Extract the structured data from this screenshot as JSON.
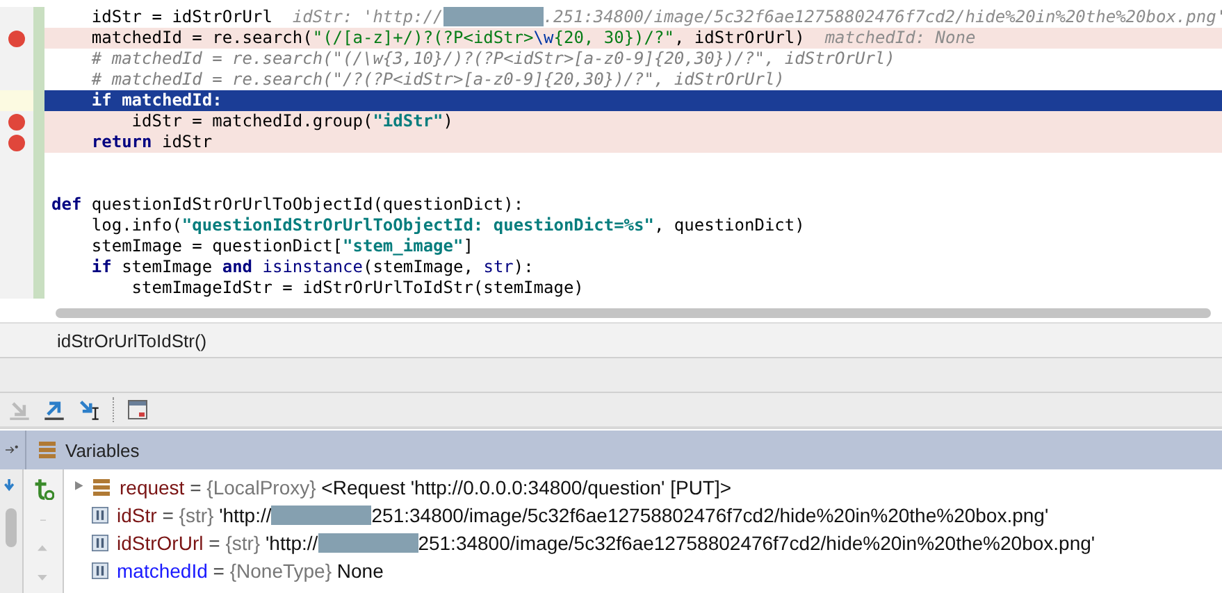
{
  "editor": {
    "lines": [
      {
        "breakpoint": false,
        "current": false,
        "segments": [
          {
            "kind": "plain",
            "text": "    idStr = idStrOrUrl"
          },
          {
            "kind": "hint",
            "text": "  idStr: 'http://"
          },
          {
            "kind": "redacted"
          },
          {
            "kind": "hint",
            "text": ".251:34800/image/5c32f6ae12758802476f7cd2/hide%20in%20the%20box.png'"
          }
        ]
      },
      {
        "breakpoint": true,
        "current": false,
        "segments": [
          {
            "kind": "plain",
            "text": "    matchedId = re.search("
          },
          {
            "kind": "string",
            "text": "\"(/[a-z]+/)?(?P<idStr>"
          },
          {
            "kind": "escape",
            "text": "\\w"
          },
          {
            "kind": "string",
            "text": "{20, 30})/?\""
          },
          {
            "kind": "plain",
            "text": ", idStrOrUrl)"
          },
          {
            "kind": "hint",
            "text": "  matchedId: None"
          }
        ]
      },
      {
        "breakpoint": false,
        "current": false,
        "segments": [
          {
            "kind": "comment",
            "text": "    # matchedId = re.search(\"(/\\w{3,10}/)?(?P<idStr>[a-z0-9]{20,30})/?\", idStrOrUrl)"
          }
        ]
      },
      {
        "breakpoint": false,
        "current": false,
        "segments": [
          {
            "kind": "comment",
            "text": "    # matchedId = re.search(\"/?(?P<idStr>[a-z0-9]{20,30})/?\", idStrOrUrl)"
          }
        ]
      },
      {
        "breakpoint": false,
        "current": true,
        "segments": [
          {
            "kind": "keyword",
            "text": "    if"
          },
          {
            "kind": "plain",
            "text": " matchedId:"
          }
        ]
      },
      {
        "breakpoint": true,
        "current": false,
        "segments": [
          {
            "kind": "plain",
            "text": "        idStr = matchedId.group("
          },
          {
            "kind": "boldstring",
            "text": "\"idStr\""
          },
          {
            "kind": "plain",
            "text": ")"
          }
        ]
      },
      {
        "breakpoint": true,
        "current": false,
        "segments": [
          {
            "kind": "keyword",
            "text": "    return"
          },
          {
            "kind": "plain",
            "text": " idStr"
          }
        ]
      },
      {
        "breakpoint": false,
        "current": false
      },
      {
        "breakpoint": false,
        "current": false
      },
      {
        "breakpoint": false,
        "current": false,
        "segments": [
          {
            "kind": "keyword",
            "text": "def"
          },
          {
            "kind": "plain",
            "text": " questionIdStrOrUrlToObjectId(questionDict):"
          }
        ]
      },
      {
        "breakpoint": false,
        "current": false,
        "segments": [
          {
            "kind": "plain",
            "text": "    log.info("
          },
          {
            "kind": "boldstring",
            "text": "\"questionIdStrOrUrlToObjectId: questionDict=%s\""
          },
          {
            "kind": "plain",
            "text": ", questionDict)"
          }
        ]
      },
      {
        "breakpoint": false,
        "current": false,
        "segments": [
          {
            "kind": "plain",
            "text": "    stemImage = questionDict["
          },
          {
            "kind": "boldstring",
            "text": "\"stem_image\""
          },
          {
            "kind": "plain",
            "text": "]"
          }
        ]
      },
      {
        "breakpoint": false,
        "current": false,
        "segments": [
          {
            "kind": "keyword",
            "text": "    if"
          },
          {
            "kind": "plain",
            "text": " stemImage "
          },
          {
            "kind": "keyword",
            "text": "and"
          },
          {
            "kind": "builtin",
            "text": " isinstance"
          },
          {
            "kind": "plain",
            "text": "(stemImage, "
          },
          {
            "kind": "builtin",
            "text": "str"
          },
          {
            "kind": "plain",
            "text": "):"
          }
        ]
      },
      {
        "breakpoint": false,
        "current": false,
        "segments": [
          {
            "kind": "plain",
            "text": "        stemImageIdStr = idStrOrUrlToIdStr(stemImage)"
          }
        ]
      }
    ]
  },
  "breadcrumb": "idStrOrUrlToIdStr()",
  "panel": {
    "title": "Variables"
  },
  "variables": [
    {
      "kind": "object",
      "expandable": true,
      "changed": false,
      "name": "request",
      "equals": "=",
      "type": "{LocalProxy}",
      "value": [
        "<Request 'http://0.0.0.0:34800/question' [PUT]>"
      ]
    },
    {
      "kind": "value",
      "expandable": false,
      "changed": false,
      "name": "idStr",
      "equals": "=",
      "type": "{str}",
      "value": [
        "'http://",
        "251:34800/image/5c32f6ae12758802476f7cd2/hide%20in%20the%20box.png'"
      ]
    },
    {
      "kind": "value",
      "expandable": false,
      "changed": false,
      "name": "idStrOrUrl",
      "equals": "=",
      "type": "{str}",
      "value": [
        "'http://",
        "251:34800/image/5c32f6ae12758802476f7cd2/hide%20in%20the%20box.png'"
      ]
    },
    {
      "kind": "value",
      "expandable": false,
      "changed": true,
      "name": "matchedId",
      "equals": "=",
      "type": "{NoneType}",
      "value": [
        "None"
      ]
    }
  ]
}
